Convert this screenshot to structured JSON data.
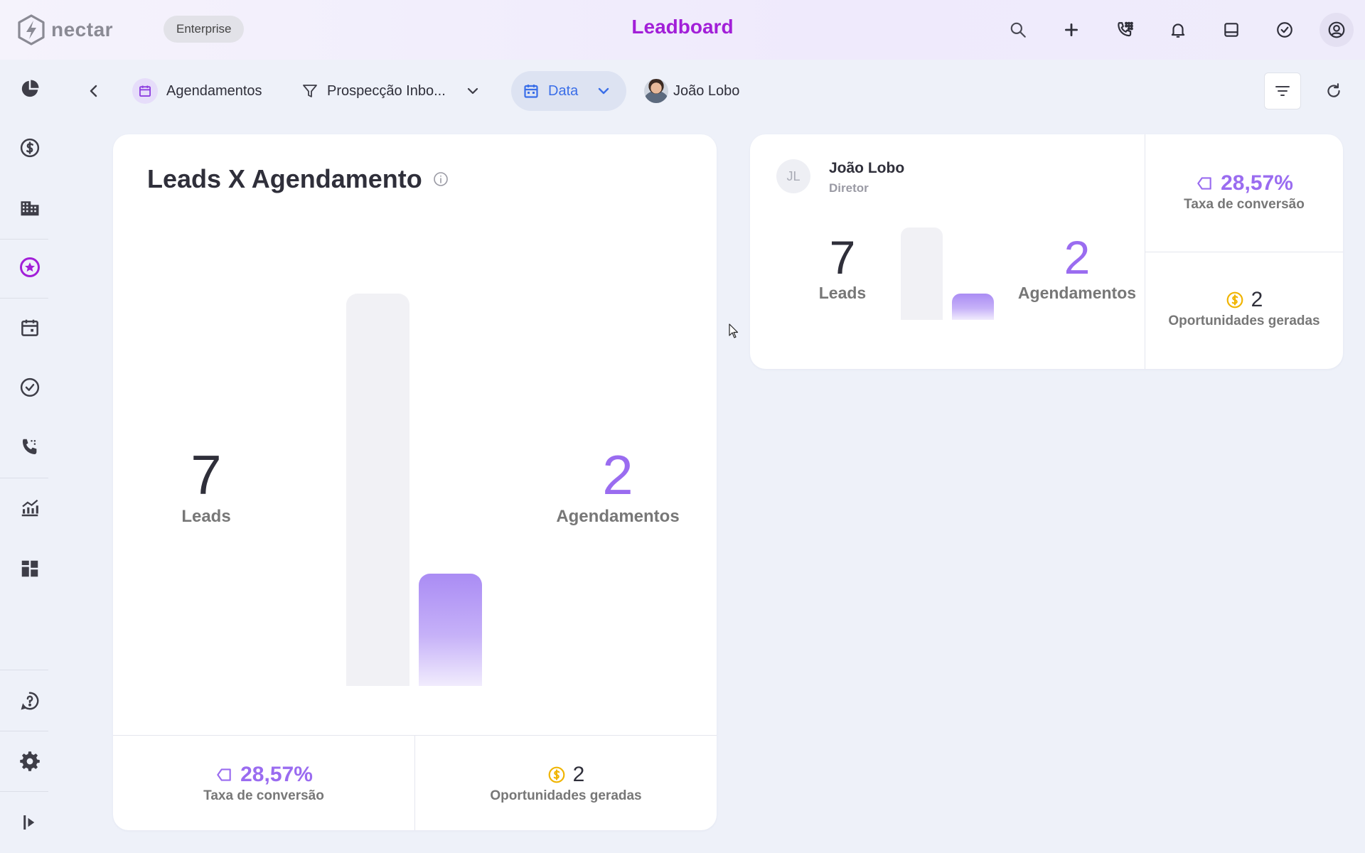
{
  "app": {
    "logo_text": "nectar",
    "plan_badge": "Enterprise",
    "title": "Leadboard"
  },
  "top_actions": [
    "search-icon",
    "plus-icon",
    "dialpad-phone-icon",
    "bell-icon",
    "inbox-icon",
    "check-circle-icon",
    "user-circle-icon"
  ],
  "sidebar": {
    "items": [
      "pie-chart-icon",
      "dollar-icon",
      "building-icon",
      "star-circle-icon",
      "calendar-icon",
      "check-circle-icon",
      "phone-icon",
      "chart-icon",
      "dashboard-icon",
      "help-icon",
      "gear-icon",
      "expand-icon"
    ],
    "active": "star-circle-icon",
    "active_color": "#a21fd8"
  },
  "filters": {
    "type_label": "Agendamentos",
    "pipeline_label": "Prospecção Inbo...",
    "date_label": "Data",
    "user_label": "João Lobo"
  },
  "main_chart": {
    "title": "Leads X Agendamento",
    "leads_value": "7",
    "leads_label": "Leads",
    "appointments_value": "2",
    "appointments_label": "Agendamentos",
    "conversion_value": "28,57%",
    "conversion_label": "Taxa de conversão",
    "opportunities_value": "2",
    "opportunities_label": "Oportunidades geradas"
  },
  "chart_data": {
    "type": "bar",
    "categories": [
      "Leads",
      "Agendamentos"
    ],
    "values": [
      7,
      2
    ]
  },
  "user_card": {
    "initials": "JL",
    "name": "João Lobo",
    "role": "Diretor",
    "leads_value": "7",
    "leads_label": "Leads",
    "appointments_value": "2",
    "appointments_label": "Agendamentos",
    "conversion_value": "28,57%",
    "conversion_label": "Taxa de conversão",
    "opportunities_value": "2",
    "opportunities_label": "Oportunidades geradas"
  },
  "colors": {
    "brand": "#a21fd8",
    "accent_purple": "#9a6cf0",
    "date_blue": "#3a6ee8",
    "coin_yellow": "#f0b400"
  }
}
